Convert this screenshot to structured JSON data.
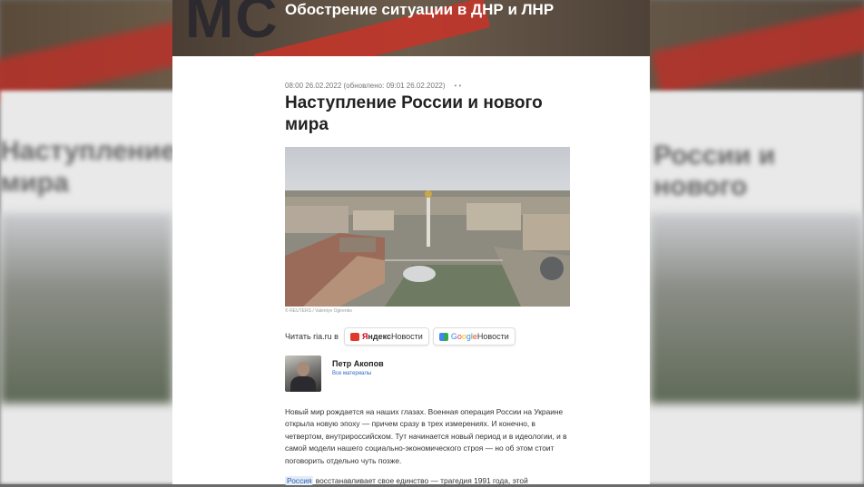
{
  "header": {
    "logo_letters": "MC",
    "title": "Обострение ситуации в ДНР и ЛНР"
  },
  "background": {
    "left_title": "Наступление Р",
    "left_title_2": "мира",
    "right_title": "России и нового"
  },
  "article": {
    "meta": "08:00 26.02.2022 (обновлено: 09:01 26.02.2022)",
    "meta_dots": "• •",
    "title": "Наступление России и нового мира",
    "photo_credit": "© REUTERS / Valentyn Ogirenko",
    "read_label": "Читать ria.ru в",
    "yandex_label_y": "Я",
    "yandex_label_rest": "ндекс",
    "yandex_news": " Новости",
    "google_news": " Новости",
    "author_name": "Петр Акопов",
    "author_link": "Все материалы",
    "paragraph": "Новый мир рождается на наших глазах. Военная операция России на Украине открыла новую эпоху — причем сразу в трех измерениях. И конечно, в четвертом, внутрироссийском. Тут начинается новый период и в идеологии, и в самой модели нашего социально-экономического строя — но об этом стоит поговорить отдельно чуть позже.",
    "tag": "Россия",
    "paragraph2": " восстанавливает свое единство — трагедия 1991 года, этой"
  },
  "colors": {
    "accent_red": "#c2352a",
    "link_blue": "#2b6ac4"
  }
}
